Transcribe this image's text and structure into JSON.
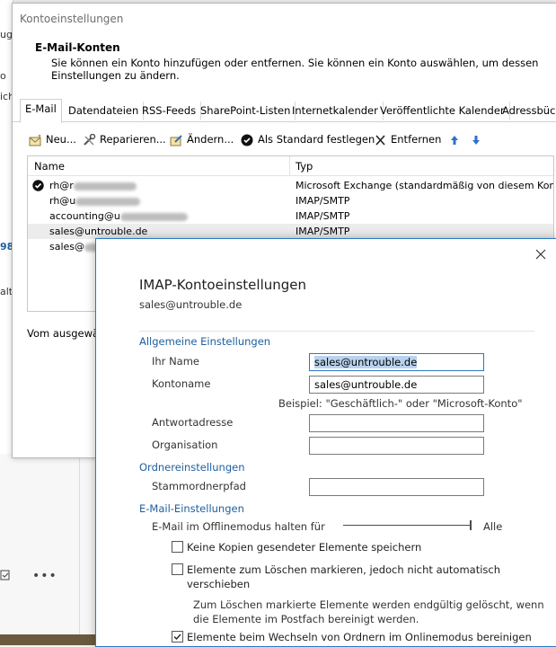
{
  "background": {
    "fragments": [
      "ug.",
      "o",
      "ich",
      "98",
      "alt"
    ],
    "more_label": "•••"
  },
  "account_window": {
    "title": "Kontoeinstellungen",
    "heading": "E-Mail-Konten",
    "description": "Sie können ein Konto hinzufügen oder entfernen. Sie können ein Konto auswählen, um dessen Einstellungen zu ändern.",
    "tabs": [
      "E-Mail",
      "Datendateien",
      "RSS-Feeds",
      "SharePoint-Listen",
      "Internetkalender",
      "Veröffentlichte Kalender",
      "Adressbüch"
    ],
    "toolbar": {
      "new": "Neu...",
      "repair": "Reparieren...",
      "change": "Ändern...",
      "set_default": "Als Standard festlegen",
      "remove": "Entfernen"
    },
    "list": {
      "col_name": "Name",
      "col_type": "Typ",
      "rows": [
        {
          "name": "rh@r",
          "type": "Microsoft Exchange (standardmäßig von diesem Kon..."
        },
        {
          "name": "rh@u",
          "type": "IMAP/SMTP"
        },
        {
          "name": "accounting@u",
          "type": "IMAP/SMTP"
        },
        {
          "name": "sales@untrouble.de",
          "type": "IMAP/SMTP"
        },
        {
          "name": "sales@",
          "type": "IMAP/SMTP"
        }
      ]
    },
    "selected_label": "Vom ausgewäh"
  },
  "imap_dialog": {
    "title": "IMAP-Kontoeinstellungen",
    "email": "sales@untrouble.de",
    "general_section": "Allgemeine Einstellungen",
    "your_name_label": "Ihr Name",
    "your_name_value": "sales@untrouble.de",
    "account_name_label": "Kontoname",
    "account_name_value": "sales@untrouble.de",
    "example": "Beispiel: \"Geschäftlich-\" oder \"Microsoft-Konto\"",
    "reply_label": "Antwortadresse",
    "reply_value": "",
    "org_label": "Organisation",
    "org_value": "",
    "folder_section": "Ordnereinstellungen",
    "root_path_label": "Stammordnerpfad",
    "root_path_value": "",
    "mail_section": "E-Mail-Einstellungen",
    "offline_label": "E-Mail im Offlinemodus halten für",
    "offline_value": "Alle",
    "offline_fraction": 1.0,
    "checkbox1_label": "Keine Kopien gesendeter Elemente speichern",
    "checkbox1_checked": false,
    "checkbox2_label_line1": "Elemente zum Löschen markieren, jedoch nicht automatisch",
    "checkbox2_label_line2": "verschieben",
    "checkbox2_checked": false,
    "note_line1": "Zum Löschen markierte Elemente werden endgültig gelöscht, wenn",
    "note_line2": "die Elemente im Postfach bereinigt werden.",
    "checkbox3_label": "Elemente beim Wechseln von Ordnern im Onlinemodus bereinigen",
    "checkbox3_checked": true
  },
  "colors": {
    "accent": "#1f5fa0",
    "dialog_border": "#2b78c5",
    "selection_highlight": "#b9d3ee"
  }
}
